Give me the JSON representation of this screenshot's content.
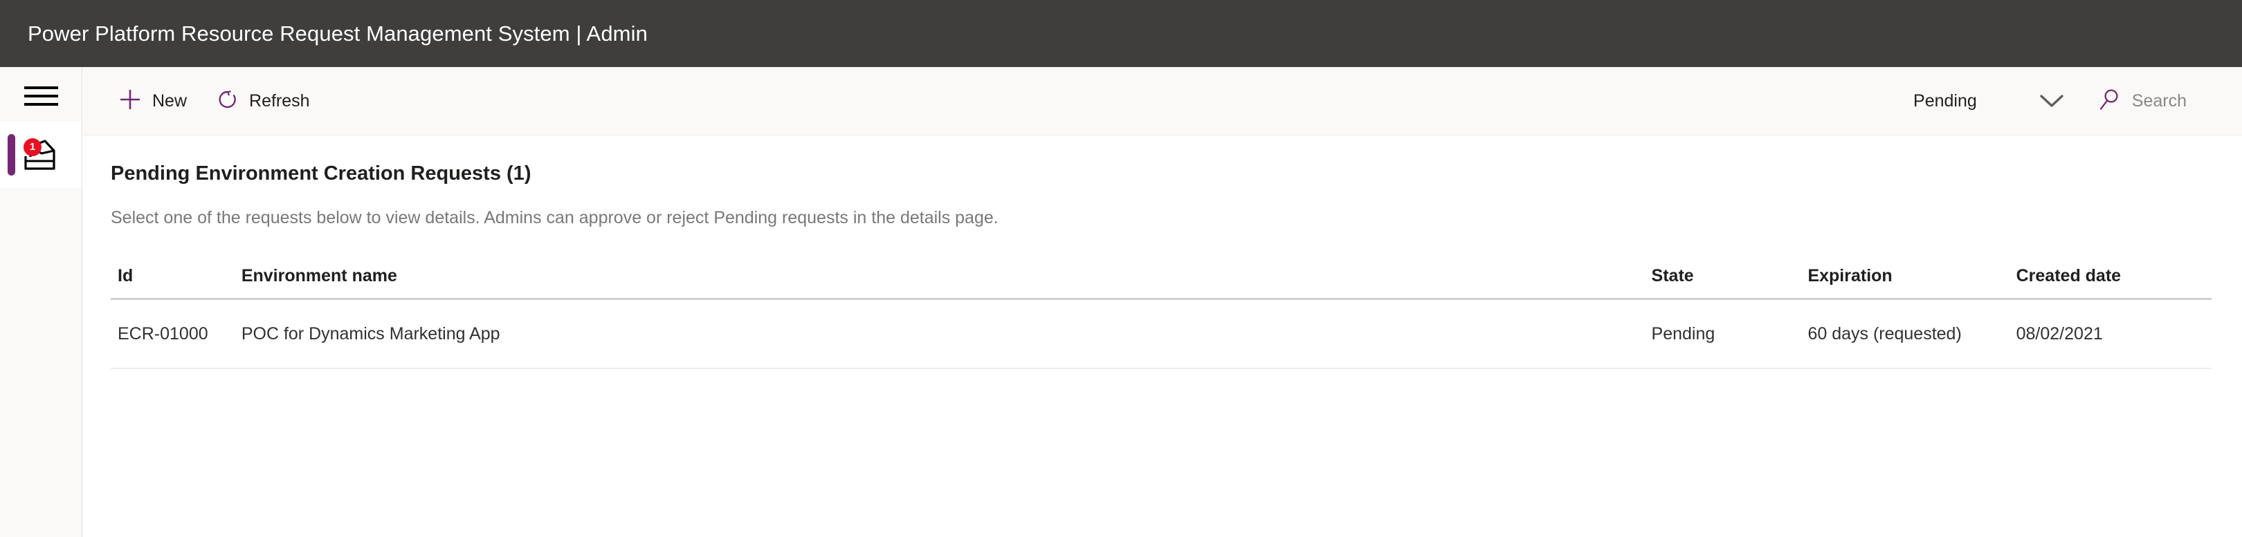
{
  "window": {
    "title": "Power Platform Resource Request Management System | Admin",
    "title_bar_color": "#3f3e3d"
  },
  "theme": {
    "accent": "#742774",
    "badge": "#e81123",
    "chrome_bg": "#faf9f8",
    "text": "#201f1e",
    "muted_text": "#7a7877"
  },
  "sidebar": {
    "menu_button": {
      "icon": "hamburger-menu-icon",
      "label": ""
    },
    "items": [
      {
        "id": "inbox",
        "icon": "inbox-tray-icon",
        "badge_count": "1",
        "active": true
      }
    ]
  },
  "command_bar": {
    "new": {
      "label": "New",
      "icon": "plus-icon"
    },
    "refresh": {
      "label": "Refresh",
      "icon": "refresh-circular-arrow-icon"
    },
    "view_selector": {
      "selected": "Pending",
      "icon": "chevron-down-icon",
      "options": [
        "Pending"
      ]
    },
    "search": {
      "placeholder": "Search",
      "value": "",
      "icon": "search-magnifier-icon"
    }
  },
  "main": {
    "heading": "Pending Environment Creation Requests (1)",
    "subtitle": "Select one of the requests below to view details. Admins can approve or reject Pending requests in the details page.",
    "table": {
      "columns": [
        {
          "key": "id",
          "label": "Id"
        },
        {
          "key": "name",
          "label": "Environment name"
        },
        {
          "key": "state",
          "label": "State"
        },
        {
          "key": "expiration",
          "label": "Expiration"
        },
        {
          "key": "created",
          "label": "Created date"
        }
      ],
      "rows": [
        {
          "id": "ECR-01000",
          "name": "POC for Dynamics Marketing App",
          "state": "Pending",
          "expiration": "60 days (requested)",
          "created": "08/02/2021"
        }
      ]
    }
  }
}
